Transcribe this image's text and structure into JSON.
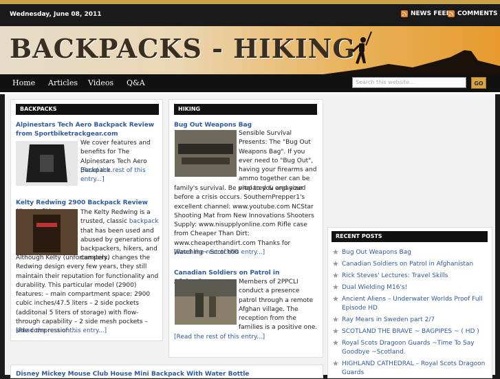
{
  "topbar": {
    "date": "Wednesday, June 08, 2011",
    "news_feed": "NEWS FEED",
    "comments": "COMMENTS"
  },
  "header": {
    "logo": "BACKPACKS - HIKING"
  },
  "nav": {
    "items": [
      "Home",
      "Articles",
      "Videos",
      "Q&A"
    ]
  },
  "search": {
    "placeholder": "Search this website...",
    "button": "GO"
  },
  "backpacks": {
    "heading": "BACKPACKS",
    "post1_title": "Alpinestars Tech Aero Backpack Review from Sportbiketrackgear.com",
    "post1_text": "We cover features and benefits for The Alpinestars Tech Aero Backpack.",
    "post1_more": "[Read the rest of this entry...]",
    "post2_title": "Kelty Redwing 2900 Backpack Review (Part1of2)",
    "post2_text": "The Kelty Redwing is a trusted, classic backpack that has been used and abused by generations of backpackers, hikers, and campers. Although Kelty (unfortunately) changes the Redwing design every few years, they still maintain their reputation for functionality and durability. This particular model (2900) features: – main compartment space: 2900 cubic inches/47.5 liters – 2 side pockets (additonal 5 liters of storage) with flow-through capability – 2 side mesh pockets – side compression …",
    "post2_more": "[Read the rest of this entry...]"
  },
  "hiking": {
    "heading": "HIKING",
    "post1_title": "Bug Out Weapons Bag",
    "post1_text": "Sensible Survival Presents: The \"Bug Out Weapons Bag\". If you ever need to \"Bug Out\", having your firearms and ammo together can be vital to you and your family's survival. Be prepared & organized before a crisis occurs. SouthernPrepper1's excellent channel: www.youtube.com NCStar Shooting Mat from New Innovations Shooters Supply: www.nisupplyonline.com Rifle case from Cheaper Than Dirt: www.cheaperthandirt.com Thanks for Watching~ Scotch00",
    "post1_more": "[Read the rest of this entry...]",
    "post2_title": "Canadian Soldiers on Patrol in Afghanistan",
    "post2_text": "Members of 2PPCLI conduct a presence patrol through a remote Afghan village. The reception from the families is a positive one.",
    "post2_more": "[Read the rest of this entry...]"
  },
  "bottom": {
    "title": "Disney Mickey Mouse Club House Mini Backpack With Water Bottle"
  },
  "recent": {
    "heading": "RECENT POSTS",
    "items": [
      "Bug Out Weapons Bag",
      "Canadian Soldiers on Patrol in Afghanistan",
      "Rick Steves' Lectures: Travel Skills",
      "Dual Wielding M16's!",
      "Ancient Aliens – Underwater Worlds Proof Full Episode HD",
      "Ray Mears in Sweden part 2/7",
      "SCOTLAND THE BRAVE ~ BAGPIPES ~ ( HD )",
      "Royal Scots Dragoon Guards ~Time To Say Goodbye ~Scotland.",
      "HIGHLAND CATHEDRAL – Royal Scots Dragoon Guards"
    ]
  },
  "colors": {
    "accent": "#c9a24a",
    "link": "#2d5aa0",
    "header_bg": "#111111"
  }
}
